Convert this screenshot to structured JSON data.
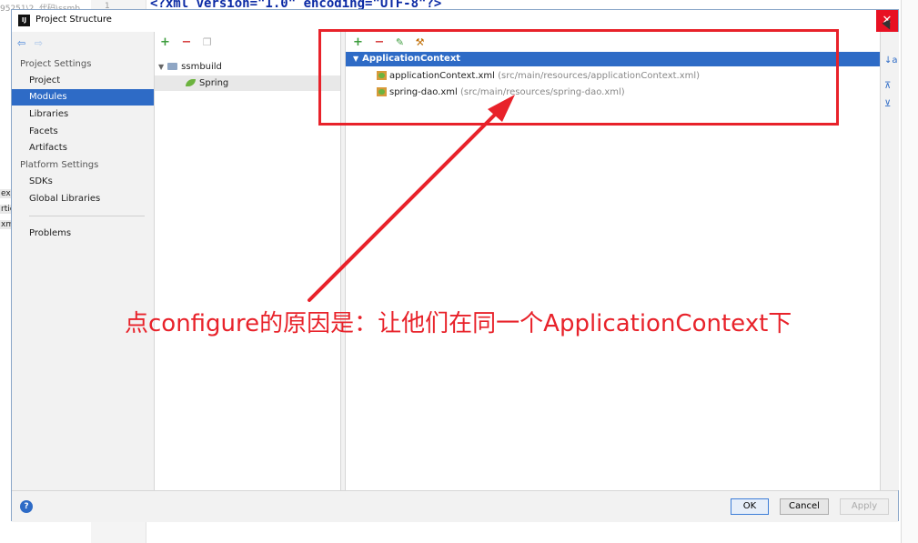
{
  "background": {
    "code_line": "<?xml version=\"1.0\" encoding=\"UTF-8\"?>",
    "path_fragment": "95251\\2. 代码\\ssmb",
    "line_number": "1",
    "left_fragments": [
      "ext.",
      "rtie",
      "xml"
    ]
  },
  "dialog": {
    "title": "Project Structure",
    "logo_text": "IJ",
    "close_symbol": "✕"
  },
  "nav": {
    "back_symbol": "⇦",
    "forward_symbol": "⇨",
    "project_settings_title": "Project Settings",
    "platform_settings_title": "Platform Settings",
    "items": [
      {
        "label": "Project"
      },
      {
        "label": "Modules"
      },
      {
        "label": "Libraries"
      },
      {
        "label": "Facets"
      },
      {
        "label": "Artifacts"
      },
      {
        "label": "SDKs"
      },
      {
        "label": "Global Libraries"
      },
      {
        "label": "Problems"
      }
    ],
    "selected": "Modules"
  },
  "tree_toolbar": {
    "add": "+",
    "remove": "−",
    "copy": "❐"
  },
  "tree": {
    "module": "ssmbuild",
    "facet": "Spring"
  },
  "ctx_toolbar": {
    "add": "+",
    "remove": "−",
    "edit": "✎",
    "tools": "⚒"
  },
  "contexts": {
    "header": "ApplicationContext",
    "files": [
      {
        "name": "applicationContext.xml",
        "path": "(src/main/resources/applicationContext.xml)"
      },
      {
        "name": "spring-dao.xml",
        "path": "(src/main/resources/spring-dao.xml)"
      }
    ]
  },
  "side_tools": {
    "sort": "↓a",
    "expand": "⊼",
    "collapse": "⊻"
  },
  "footer": {
    "help": "?",
    "ok": "OK",
    "cancel": "Cancel",
    "apply": "Apply"
  },
  "annotation": {
    "text": "点configure的原因是：让他们在同一个ApplicationContext下",
    "color": "#e8222a"
  }
}
